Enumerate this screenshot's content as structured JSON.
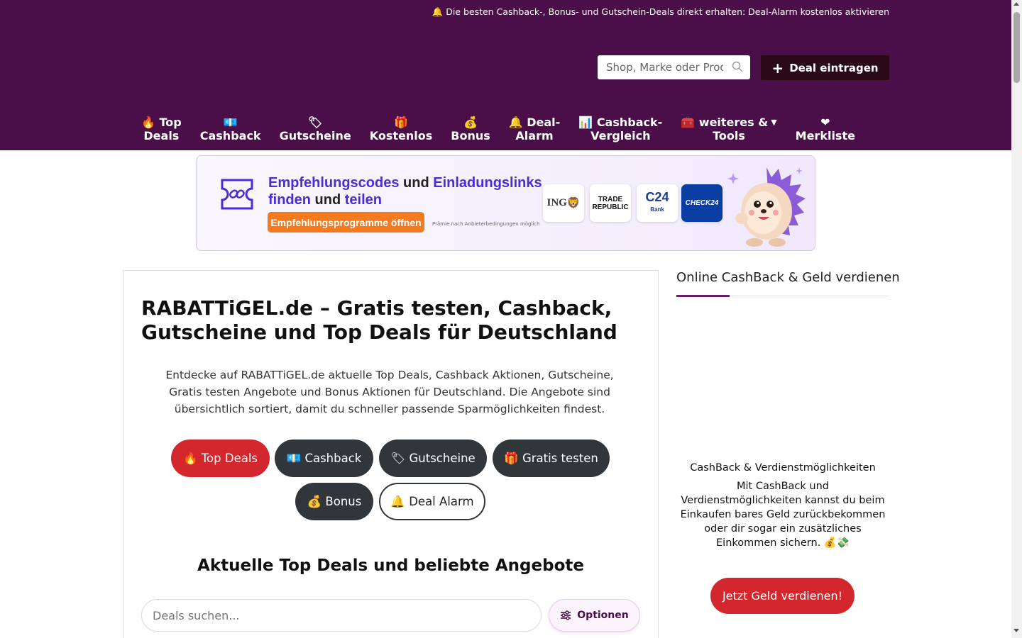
{
  "header": {
    "topbar_text": "🔔 Die besten Cashback-, Bonus- und Gutschein-Deals direkt erhalten: Deal-Alarm kostenlos aktivieren",
    "search_placeholder": "Shop, Marke oder Produkt",
    "deal_button": "Deal eintragen",
    "bg_color": "#4a0f48"
  },
  "nav": {
    "items": [
      {
        "icon": "🔥",
        "label_1": "Top",
        "label_2": "Deals"
      },
      {
        "icon": "💶",
        "label_1": "",
        "label_2": "Cashback"
      },
      {
        "icon": "🏷",
        "label_1": "",
        "label_2": "Gutscheine"
      },
      {
        "icon": "🎁",
        "label_1": "",
        "label_2": "Kostenlos"
      },
      {
        "icon": "💰",
        "label_1": "",
        "label_2": "Bonus"
      },
      {
        "icon": "🔔",
        "label_1": "Deal-",
        "label_2": "Alarm"
      },
      {
        "icon": "📊",
        "label_1": "Cashback-",
        "label_2": "Vergleich"
      },
      {
        "icon": "🧰",
        "label_1": "weiteres &",
        "label_2": "Tools"
      },
      {
        "icon": "❤",
        "label_1": "",
        "label_2": "Merkliste"
      }
    ]
  },
  "banner": {
    "title_part1": "Empfehlungscodes",
    "title_part2": " und ",
    "title_part3": "Einladungslinks",
    "title_part4": "finden",
    "title_part5": " und ",
    "title_part6": "teilen",
    "button": "Empfehlungsprogramme öffnen",
    "note": "Prämie nach Anbieterbedingungen möglich",
    "logos": {
      "ing": "ING",
      "trade_republic_1": "TRADE",
      "trade_republic_2": "REPUBLIC",
      "c24": "C24",
      "c24_sub": "Bank",
      "check24": "CHECK24"
    }
  },
  "main": {
    "title": "RABATTiGEL.de – Gratis testen, Cashback, Gutscheine und Top Deals für Deutschland",
    "intro": "Entdecke auf RABATTiGEL.de aktuelle Top Deals, Cashback Aktionen, Gutscheine, Gratis testen Angebote und Bonus Aktionen für Deutschland. Die Angebote sind übersichtlich sortiert, damit du schneller passende Sparmöglichkeiten findest.",
    "pills": {
      "top_deals": "🔥 Top Deals",
      "cashback": "💶 Cashback",
      "gutscheine": "🏷 Gutscheine",
      "gratis_testen": "🎁 Gratis testen",
      "bonus": "💰 Bonus",
      "deal_alarm": "🔔 Deal Alarm"
    },
    "section_title": "Aktuelle Top Deals und beliebte Angebote",
    "deal_search_placeholder": "Deals suchen...",
    "options_button": "Optionen"
  },
  "sidebar": {
    "title": "Online CashBack & Geld verdienen",
    "heading": "CashBack & Verdienstmöglichkeiten",
    "text_1": "Mit CashBack und Verdienstmöglichkeiten kannst du beim Einkaufen bares Geld zurückbekommen",
    "text_2": "oder dir sogar ein zusätzliches Einkommen sichern. 💰💸",
    "button": "Jetzt Geld verdienen!"
  }
}
